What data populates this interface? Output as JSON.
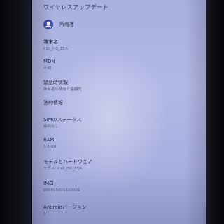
{
  "header": {
    "title": "ワイヤレスアップデート"
  },
  "owner": {
    "label": "所有者",
    "icon": "account-circle-icon"
  },
  "items": [
    {
      "title": "端末名",
      "value": "P10_HD_EEA"
    },
    {
      "title": "MDN",
      "value": "不明"
    },
    {
      "title": "緊急時情報",
      "value": "所有者の情報と連絡先"
    },
    {
      "title": "法的情報",
      "value": ""
    },
    {
      "title": "SIMのステータス",
      "value": "接続なし"
    },
    {
      "title": "RAM",
      "value": "3.0 GB"
    },
    {
      "title": "モデルとハードウェア",
      "value": "モデル: P10_HD_EEA"
    },
    {
      "title": "IMEI",
      "value": "866605031123861"
    },
    {
      "title": "Androidバージョン",
      "value": "9"
    }
  ],
  "colors": {
    "screen": "#b0b6e3",
    "avatar": "#3f4fa8",
    "bezel": "#0b0b12"
  }
}
